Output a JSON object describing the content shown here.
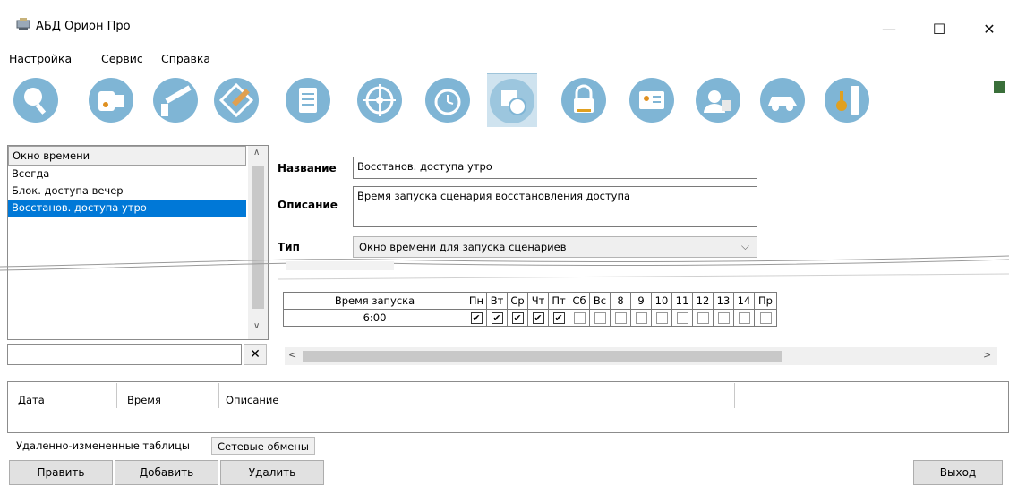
{
  "window": {
    "title": "АБД Орион Про",
    "minimize": "—",
    "maximize": "☐",
    "close": "✕"
  },
  "menu": [
    "Настройка",
    "Сервис",
    "Справка"
  ],
  "toolbar": [
    {
      "icon": "search-icon"
    },
    {
      "icon": "device-icon"
    },
    {
      "icon": "barrier-icon"
    },
    {
      "icon": "map-edit-icon"
    },
    {
      "icon": "document-icon"
    },
    {
      "icon": "wheel-icon"
    },
    {
      "icon": "alarm-clock-icon"
    },
    {
      "icon": "schedule-icon",
      "active": true
    },
    {
      "icon": "lock-icon"
    },
    {
      "icon": "id-card-icon"
    },
    {
      "icon": "users-icon"
    },
    {
      "icon": "car-icon"
    },
    {
      "icon": "key-icon"
    }
  ],
  "left_list": {
    "header": "Окно времени",
    "items": [
      "Всегда",
      "Блок. доступа вечер",
      "Восстанов. доступа утро"
    ],
    "selected_index": 2,
    "filter_value": "",
    "clear_label": "✕"
  },
  "form": {
    "name_label": "Название",
    "name_value": "Восстанов. доступа утро",
    "description_label": "Описание",
    "description_value": "Время запуска сценария восстановления доступа",
    "type_label": "Тип",
    "type_value": "Окно времени для запуска сценариев"
  },
  "grid": {
    "headers": [
      "Время запуска",
      "Пн",
      "Вт",
      "Ср",
      "Чт",
      "Пт",
      "Сб",
      "Вс",
      "8",
      "9",
      "10",
      "11",
      "12",
      "13",
      "14",
      "Пр"
    ],
    "row": {
      "time": "6:00",
      "checks": [
        true,
        true,
        true,
        true,
        true,
        false,
        false,
        false,
        false,
        false,
        false,
        false,
        false,
        false,
        false
      ]
    }
  },
  "log": {
    "columns": [
      "Дата",
      "Время",
      "Описание"
    ]
  },
  "tabs": [
    "Удаленно-измененные таблицы",
    "Сетевые обмены"
  ],
  "buttons": {
    "edit": "Править",
    "add": "Добавить",
    "delete": "Удалить",
    "exit": "Выход"
  },
  "colors": {
    "accent": "#0078d7",
    "toolbar_icon": "#7fb5d5"
  }
}
